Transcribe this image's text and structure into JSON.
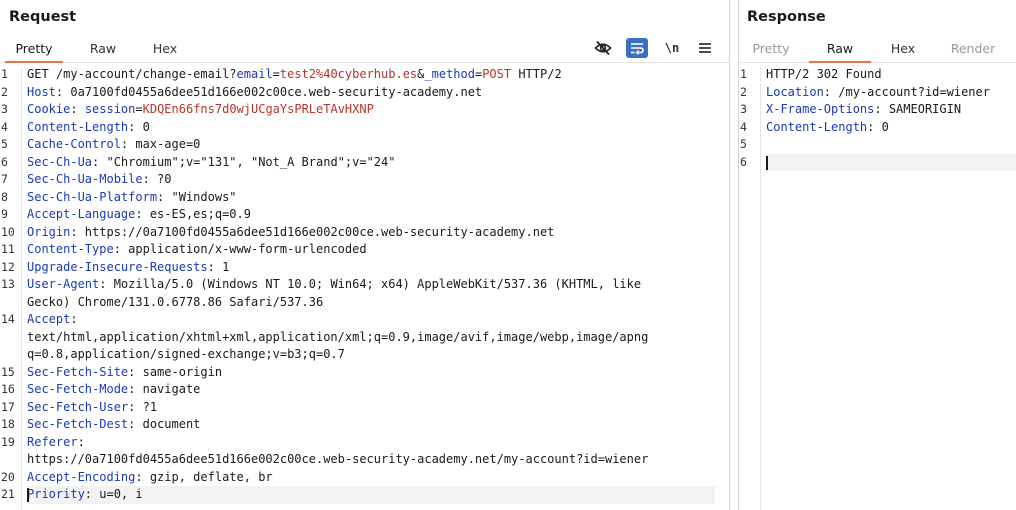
{
  "request": {
    "title": "Request",
    "tabs": [
      {
        "label": "Pretty",
        "active": true
      },
      {
        "label": "Raw",
        "active": false
      },
      {
        "label": "Hex",
        "active": false
      }
    ],
    "toolbar": {
      "hide_icon": "eye-slash-icon",
      "wrap_icon": "wrap-lines-icon",
      "newline_label": "\\n",
      "menu_icon": "hamburger-menu-icon"
    },
    "lines": [
      {
        "n": "1",
        "parts": [
          {
            "t": "GET /my-account/change-email?",
            "c": "sp"
          },
          {
            "t": "email",
            "c": "pk"
          },
          {
            "t": "=",
            "c": "sp"
          },
          {
            "t": "test2%40cyberhub.es",
            "c": "pv"
          },
          {
            "t": "&",
            "c": "sp"
          },
          {
            "t": "_method",
            "c": "pk"
          },
          {
            "t": "=",
            "c": "sp"
          },
          {
            "t": "POST",
            "c": "pv"
          },
          {
            "t": " HTTP/2",
            "c": "sp"
          }
        ]
      },
      {
        "n": "2",
        "parts": [
          {
            "t": "Host",
            "c": "hk"
          },
          {
            "t": ": 0a7100fd0455a6dee51d166e002c00ce.web-security-academy.net",
            "c": "hv"
          }
        ]
      },
      {
        "n": "3",
        "parts": [
          {
            "t": "Cookie",
            "c": "hk"
          },
          {
            "t": ": ",
            "c": "hv"
          },
          {
            "t": "session",
            "c": "pk"
          },
          {
            "t": "=",
            "c": "sp"
          },
          {
            "t": "KDQEn66fns7d0wjUCgaYsPRLeTAvHXNP",
            "c": "pv"
          }
        ]
      },
      {
        "n": "4",
        "parts": [
          {
            "t": "Content-Length",
            "c": "hk"
          },
          {
            "t": ": 0",
            "c": "hv"
          }
        ]
      },
      {
        "n": "5",
        "parts": [
          {
            "t": "Cache-Control",
            "c": "hk"
          },
          {
            "t": ": max-age=0",
            "c": "hv"
          }
        ]
      },
      {
        "n": "6",
        "parts": [
          {
            "t": "Sec-Ch-Ua",
            "c": "hk"
          },
          {
            "t": ": \"Chromium\";v=\"131\", \"Not_A Brand\";v=\"24\"",
            "c": "hv"
          }
        ]
      },
      {
        "n": "7",
        "parts": [
          {
            "t": "Sec-Ch-Ua-Mobile",
            "c": "hk"
          },
          {
            "t": ": ?0",
            "c": "hv"
          }
        ]
      },
      {
        "n": "8",
        "parts": [
          {
            "t": "Sec-Ch-Ua-Platform",
            "c": "hk"
          },
          {
            "t": ": \"Windows\"",
            "c": "hv"
          }
        ]
      },
      {
        "n": "9",
        "parts": [
          {
            "t": "Accept-Language",
            "c": "hk"
          },
          {
            "t": ": es-ES,es;q=0.9",
            "c": "hv"
          }
        ]
      },
      {
        "n": "10",
        "parts": [
          {
            "t": "Origin",
            "c": "hk"
          },
          {
            "t": ": https://0a7100fd0455a6dee51d166e002c00ce.web-security-academy.net",
            "c": "hv"
          }
        ]
      },
      {
        "n": "11",
        "parts": [
          {
            "t": "Content-Type",
            "c": "hk"
          },
          {
            "t": ": application/x-www-form-urlencoded",
            "c": "hv"
          }
        ]
      },
      {
        "n": "12",
        "parts": [
          {
            "t": "Upgrade-Insecure-Requests",
            "c": "hk"
          },
          {
            "t": ": 1",
            "c": "hv"
          }
        ]
      },
      {
        "n": "13",
        "parts": [
          {
            "t": "User-Agent",
            "c": "hk"
          },
          {
            "t": ": Mozilla/5.0 (Windows NT 10.0; Win64; x64) AppleWebKit/537.36 (KHTML, like",
            "c": "hv"
          }
        ]
      },
      {
        "n": "",
        "parts": [
          {
            "t": "Gecko) Chrome/131.0.6778.86 Safari/537.36",
            "c": "hv"
          }
        ]
      },
      {
        "n": "14",
        "parts": [
          {
            "t": "Accept",
            "c": "hk"
          },
          {
            "t": ":",
            "c": "hv"
          }
        ]
      },
      {
        "n": "",
        "parts": [
          {
            "t": "text/html,application/xhtml+xml,application/xml;q=0.9,image/avif,image/webp,image/apng",
            "c": "hv"
          }
        ]
      },
      {
        "n": "",
        "parts": [
          {
            "t": "q=0.8,application/signed-exchange;v=b3;q=0.7",
            "c": "hv"
          }
        ]
      },
      {
        "n": "15",
        "parts": [
          {
            "t": "Sec-Fetch-Site",
            "c": "hk"
          },
          {
            "t": ": same-origin",
            "c": "hv"
          }
        ]
      },
      {
        "n": "16",
        "parts": [
          {
            "t": "Sec-Fetch-Mode",
            "c": "hk"
          },
          {
            "t": ": navigate",
            "c": "hv"
          }
        ]
      },
      {
        "n": "17",
        "parts": [
          {
            "t": "Sec-Fetch-User",
            "c": "hk"
          },
          {
            "t": ": ?1",
            "c": "hv"
          }
        ]
      },
      {
        "n": "18",
        "parts": [
          {
            "t": "Sec-Fetch-Dest",
            "c": "hk"
          },
          {
            "t": ": document",
            "c": "hv"
          }
        ]
      },
      {
        "n": "19",
        "parts": [
          {
            "t": "Referer",
            "c": "hk"
          },
          {
            "t": ":",
            "c": "hv"
          }
        ]
      },
      {
        "n": "",
        "parts": [
          {
            "t": "https://0a7100fd0455a6dee51d166e002c00ce.web-security-academy.net/my-account?id=wiener",
            "c": "hv"
          }
        ]
      },
      {
        "n": "20",
        "parts": [
          {
            "t": "Accept-Encoding",
            "c": "hk"
          },
          {
            "t": ": gzip, deflate, br",
            "c": "hv"
          }
        ]
      },
      {
        "n": "21",
        "parts": [
          {
            "t": "Priority",
            "c": "hk"
          },
          {
            "t": ": u=0, i",
            "c": "hv"
          }
        ],
        "cursor": true
      }
    ]
  },
  "response": {
    "title": "Response",
    "tabs": [
      {
        "label": "Pretty",
        "active": false,
        "disabled": true
      },
      {
        "label": "Raw",
        "active": true
      },
      {
        "label": "Hex",
        "active": false
      },
      {
        "label": "Render",
        "active": false,
        "disabled": true
      }
    ],
    "lines": [
      {
        "n": "1",
        "parts": [
          {
            "t": "HTTP/2 302 Found",
            "c": "hv"
          }
        ]
      },
      {
        "n": "2",
        "parts": [
          {
            "t": "Location",
            "c": "hk"
          },
          {
            "t": ": /my-account?id=wiener",
            "c": "hv"
          }
        ]
      },
      {
        "n": "3",
        "parts": [
          {
            "t": "X-Frame-Options",
            "c": "hk"
          },
          {
            "t": ": SAMEORIGIN",
            "c": "hv"
          }
        ]
      },
      {
        "n": "4",
        "parts": [
          {
            "t": "Content-Length",
            "c": "hk"
          },
          {
            "t": ": 0",
            "c": "hv"
          }
        ]
      },
      {
        "n": "5",
        "parts": []
      },
      {
        "n": "6",
        "parts": [],
        "cursor": true
      }
    ]
  }
}
